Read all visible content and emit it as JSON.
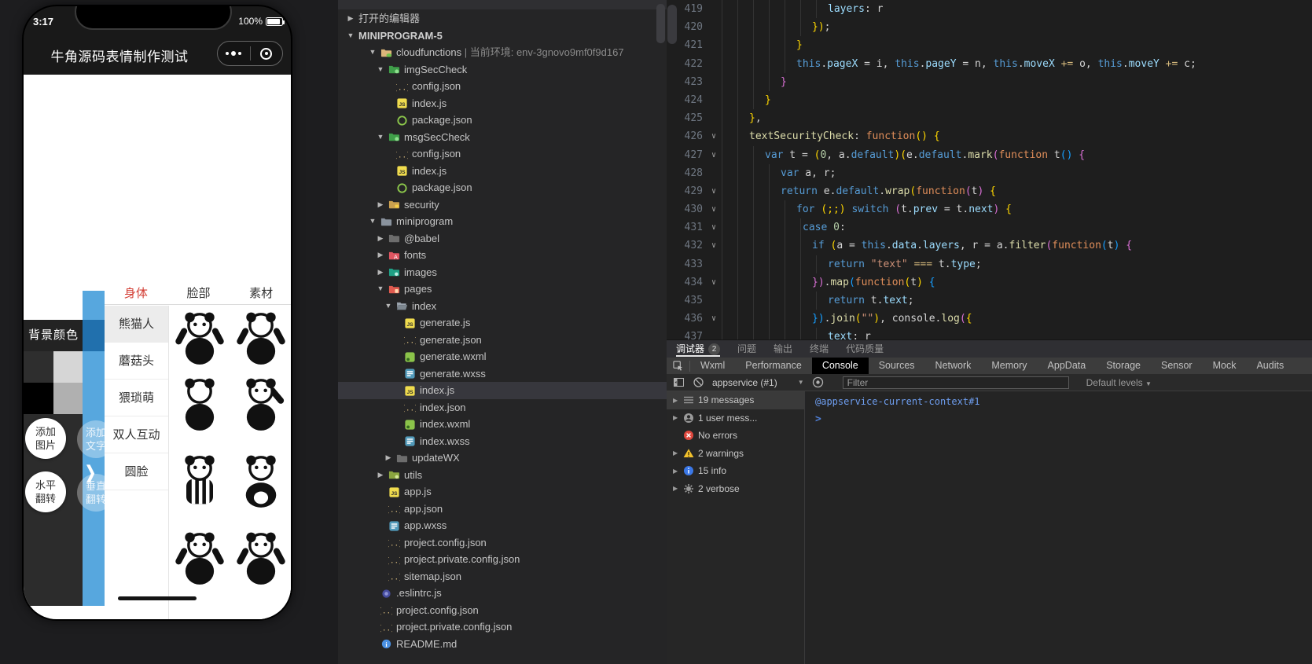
{
  "colors": {
    "accent_blue": "#57a7de",
    "drawer_dark_blue": "#2170ad",
    "tab_active_red": "#d23b31",
    "console_link_blue": "#6e9ef0",
    "swatch_indicator": "#d63c5e"
  },
  "simulator": {
    "status_time": "3:17",
    "battery_percent": "100%",
    "nav_title": "牛角源码表情制作测试",
    "tabs": [
      {
        "label": "身体",
        "active": true
      },
      {
        "label": "脸部",
        "active": false
      },
      {
        "label": "素材",
        "active": false
      }
    ],
    "color_panel": {
      "title": "背景颜色",
      "swatches": [
        "#ffffff",
        "#2e2e2e",
        "#d6d6d6",
        "#000000",
        "#b0b0b0"
      ]
    },
    "categories": [
      {
        "label": "熊猫人",
        "selected": true
      },
      {
        "label": "蘑菇头",
        "selected": false
      },
      {
        "label": "猥琐萌",
        "selected": false
      },
      {
        "label": "双人互动",
        "selected": false
      },
      {
        "label": "圆脸",
        "selected": false
      }
    ],
    "action_buttons": [
      {
        "label": "添加图片",
        "tinted": false
      },
      {
        "label": "添加文字",
        "tinted": true
      },
      {
        "label": "水平翻转",
        "tinted": false
      },
      {
        "label": "垂直翻转",
        "tinted": true
      }
    ],
    "stickers": [
      {
        "variant": "hug"
      },
      {
        "variant": "cheer"
      },
      {
        "variant": "back"
      },
      {
        "variant": "point"
      },
      {
        "variant": "pajama"
      },
      {
        "variant": "sit"
      },
      {
        "variant": "wave"
      },
      {
        "variant": "wave2"
      }
    ]
  },
  "explorer": {
    "items": [
      {
        "indent": 0,
        "arrow": "right",
        "icon": null,
        "label": "打开的编辑器",
        "bold": false
      },
      {
        "indent": 0,
        "arrow": "down",
        "icon": null,
        "label": "MINIPROGRAM-5",
        "bold": true
      },
      {
        "indent": 1,
        "arrow": "down",
        "icon": "folder-cloud",
        "label": "cloudfunctions",
        "extra": " | 当前环境: env-3gnovo9mf0f9d167"
      },
      {
        "indent": 2,
        "arrow": "down",
        "icon": "folder-func",
        "label": "imgSecCheck"
      },
      {
        "indent": 3,
        "icon": "json",
        "label": "config.json"
      },
      {
        "indent": 3,
        "icon": "js",
        "label": "index.js"
      },
      {
        "indent": 3,
        "icon": "node",
        "label": "package.json"
      },
      {
        "indent": 2,
        "arrow": "down",
        "icon": "folder-func",
        "label": "msgSecCheck"
      },
      {
        "indent": 3,
        "icon": "json",
        "label": "config.json"
      },
      {
        "indent": 3,
        "icon": "js",
        "label": "index.js"
      },
      {
        "indent": 3,
        "icon": "node",
        "label": "package.json"
      },
      {
        "indent": 2,
        "arrow": "right",
        "icon": "folder-lock",
        "label": "security"
      },
      {
        "indent": 1,
        "arrow": "down",
        "icon": "folder-mini",
        "label": "miniprogram"
      },
      {
        "indent": 2,
        "arrow": "right",
        "icon": "folder-plain",
        "label": "@babel"
      },
      {
        "indent": 2,
        "arrow": "right",
        "icon": "folder-fonts",
        "label": "fonts"
      },
      {
        "indent": 2,
        "arrow": "right",
        "icon": "folder-images",
        "label": "images"
      },
      {
        "indent": 2,
        "arrow": "down",
        "icon": "folder-pages",
        "label": "pages"
      },
      {
        "indent": 3,
        "arrow": "down",
        "icon": "folder-open",
        "label": "index"
      },
      {
        "indent": 4,
        "icon": "js",
        "label": "generate.js"
      },
      {
        "indent": 4,
        "icon": "json",
        "label": "generate.json"
      },
      {
        "indent": 4,
        "icon": "wxml",
        "label": "generate.wxml"
      },
      {
        "indent": 4,
        "icon": "wxss",
        "label": "generate.wxss"
      },
      {
        "indent": 4,
        "icon": "js",
        "label": "index.js",
        "selected": true
      },
      {
        "indent": 4,
        "icon": "json",
        "label": "index.json"
      },
      {
        "indent": 4,
        "icon": "wxml",
        "label": "index.wxml"
      },
      {
        "indent": 4,
        "icon": "wxss",
        "label": "index.wxss"
      },
      {
        "indent": 3,
        "arrow": "right",
        "icon": "folder-plain",
        "label": "updateWX"
      },
      {
        "indent": 2,
        "arrow": "right",
        "icon": "folder-utils",
        "label": "utils"
      },
      {
        "indent": 2,
        "icon": "js",
        "label": "app.js"
      },
      {
        "indent": 2,
        "icon": "json",
        "label": "app.json"
      },
      {
        "indent": 2,
        "icon": "wxss",
        "label": "app.wxss"
      },
      {
        "indent": 2,
        "icon": "json",
        "label": "project.config.json"
      },
      {
        "indent": 2,
        "icon": "json",
        "label": "project.private.config.json"
      },
      {
        "indent": 2,
        "icon": "json",
        "label": "sitemap.json"
      },
      {
        "indent": 1,
        "icon": "eslint",
        "label": ".eslintrc.js"
      },
      {
        "indent": 1,
        "icon": "json",
        "label": "project.config.json"
      },
      {
        "indent": 1,
        "icon": "json",
        "label": "project.private.config.json"
      },
      {
        "indent": 1,
        "icon": "readme",
        "label": "README.md"
      }
    ]
  },
  "editor": {
    "lines": [
      {
        "n": 419,
        "fold": false,
        "indent": 5,
        "tokens": [
          [
            "p",
            "layers"
          ],
          [
            "t",
            ": r"
          ]
        ]
      },
      {
        "n": 420,
        "fold": false,
        "indent": 4,
        "tokens": [
          [
            "g",
            "})"
          ],
          [
            "t",
            ";"
          ]
        ]
      },
      {
        "n": 421,
        "fold": false,
        "indent": 3,
        "tokens": [
          [
            "g",
            "}"
          ]
        ]
      },
      {
        "n": 422,
        "fold": false,
        "indent": 3,
        "tokens": [
          [
            "k",
            "this"
          ],
          [
            "t",
            "."
          ],
          [
            "p",
            "pageX"
          ],
          [
            "t",
            " = i, "
          ],
          [
            "k",
            "this"
          ],
          [
            "t",
            "."
          ],
          [
            "p",
            "pageY"
          ],
          [
            "t",
            " = n, "
          ],
          [
            "k",
            "this"
          ],
          [
            "t",
            "."
          ],
          [
            "p",
            "moveX"
          ],
          [
            "y",
            " += "
          ],
          [
            "t",
            "o, "
          ],
          [
            "k",
            "this"
          ],
          [
            "t",
            "."
          ],
          [
            "p",
            "moveY"
          ],
          [
            "y",
            " += "
          ],
          [
            "t",
            "c;"
          ]
        ]
      },
      {
        "n": 423,
        "fold": false,
        "indent": 2,
        "tokens": [
          [
            "m",
            "}"
          ]
        ]
      },
      {
        "n": 424,
        "fold": false,
        "indent": 1,
        "tokens": [
          [
            "g",
            "}"
          ]
        ]
      },
      {
        "n": 425,
        "fold": false,
        "indent": 0,
        "tokens": [
          [
            "g",
            "}"
          ],
          [
            "t",
            ","
          ]
        ]
      },
      {
        "n": 426,
        "fold": true,
        "indent": 0,
        "tokens": [
          [
            "f",
            "textSecurityCheck"
          ],
          [
            "t",
            ": "
          ],
          [
            "o",
            "function"
          ],
          [
            "g",
            "()"
          ],
          [
            "t",
            " "
          ],
          [
            "g",
            "{"
          ]
        ]
      },
      {
        "n": 427,
        "fold": true,
        "indent": 1,
        "tokens": [
          [
            "k",
            "var"
          ],
          [
            "t",
            " t = "
          ],
          [
            "g",
            "("
          ],
          [
            "n",
            "0"
          ],
          [
            "t",
            ", a."
          ],
          [
            "k",
            "default"
          ],
          [
            "g",
            ")("
          ],
          [
            "t",
            "e."
          ],
          [
            "k",
            "default"
          ],
          [
            "t",
            "."
          ],
          [
            "f",
            "mark"
          ],
          [
            "m",
            "("
          ],
          [
            "o",
            "function"
          ],
          [
            "t",
            " t"
          ],
          [
            "b",
            "()"
          ],
          [
            "t",
            " "
          ],
          [
            "m",
            "{"
          ]
        ]
      },
      {
        "n": 428,
        "fold": false,
        "indent": 2,
        "tokens": [
          [
            "k",
            "var"
          ],
          [
            "t",
            " a, r;"
          ]
        ]
      },
      {
        "n": 429,
        "fold": true,
        "indent": 2,
        "tokens": [
          [
            "k",
            "return"
          ],
          [
            "t",
            " e."
          ],
          [
            "k",
            "default"
          ],
          [
            "t",
            "."
          ],
          [
            "f",
            "wrap"
          ],
          [
            "g",
            "("
          ],
          [
            "o",
            "function"
          ],
          [
            "m",
            "("
          ],
          [
            "t",
            "t"
          ],
          [
            "m",
            ")"
          ],
          [
            "t",
            " "
          ],
          [
            "g",
            "{"
          ]
        ]
      },
      {
        "n": 430,
        "fold": true,
        "indent": 3,
        "tokens": [
          [
            "k",
            "for"
          ],
          [
            "t",
            " "
          ],
          [
            "g",
            "(;;)"
          ],
          [
            "t",
            " "
          ],
          [
            "k",
            "switch"
          ],
          [
            "t",
            " "
          ],
          [
            "m",
            "("
          ],
          [
            "t",
            "t."
          ],
          [
            "p",
            "prev"
          ],
          [
            "t",
            " = t."
          ],
          [
            "p",
            "next"
          ],
          [
            "m",
            ")"
          ],
          [
            "t",
            " "
          ],
          [
            "g",
            "{"
          ]
        ]
      },
      {
        "n": 431,
        "fold": true,
        "indent": 3.4,
        "tokens": [
          [
            "k",
            "case"
          ],
          [
            "t",
            " "
          ],
          [
            "n",
            "0"
          ],
          [
            "t",
            ":"
          ]
        ]
      },
      {
        "n": 432,
        "fold": true,
        "indent": 4,
        "tokens": [
          [
            "k",
            "if"
          ],
          [
            "t",
            " "
          ],
          [
            "g",
            "("
          ],
          [
            "t",
            "a = "
          ],
          [
            "k",
            "this"
          ],
          [
            "t",
            "."
          ],
          [
            "p",
            "data"
          ],
          [
            "t",
            "."
          ],
          [
            "p",
            "layers"
          ],
          [
            "t",
            ", r = a."
          ],
          [
            "f",
            "filter"
          ],
          [
            "m",
            "("
          ],
          [
            "o",
            "function"
          ],
          [
            "b",
            "("
          ],
          [
            "t",
            "t"
          ],
          [
            "b",
            ")"
          ],
          [
            "t",
            " "
          ],
          [
            "m",
            "{"
          ]
        ]
      },
      {
        "n": 433,
        "fold": false,
        "indent": 5,
        "tokens": [
          [
            "k",
            "return"
          ],
          [
            "t",
            " "
          ],
          [
            "s",
            "\"text\""
          ],
          [
            "t",
            " "
          ],
          [
            "y",
            "==="
          ],
          [
            "t",
            " t."
          ],
          [
            "p",
            "type"
          ],
          [
            "t",
            ";"
          ]
        ]
      },
      {
        "n": 434,
        "fold": true,
        "indent": 4,
        "tokens": [
          [
            "m",
            "})"
          ],
          [
            "t",
            "."
          ],
          [
            "f",
            "map"
          ],
          [
            "b",
            "("
          ],
          [
            "o",
            "function"
          ],
          [
            "g",
            "("
          ],
          [
            "t",
            "t"
          ],
          [
            "g",
            ")"
          ],
          [
            "t",
            " "
          ],
          [
            "b",
            "{"
          ]
        ]
      },
      {
        "n": 435,
        "fold": false,
        "indent": 5,
        "tokens": [
          [
            "k",
            "return"
          ],
          [
            "t",
            " t."
          ],
          [
            "p",
            "text"
          ],
          [
            "t",
            ";"
          ]
        ]
      },
      {
        "n": 436,
        "fold": true,
        "indent": 4,
        "tokens": [
          [
            "b",
            "})"
          ],
          [
            "t",
            "."
          ],
          [
            "f",
            "join"
          ],
          [
            "g",
            "("
          ],
          [
            "s",
            "\"\""
          ],
          [
            "g",
            ")"
          ],
          [
            "t",
            ", console."
          ],
          [
            "f",
            "log"
          ],
          [
            "m",
            "("
          ],
          [
            "g",
            "{"
          ]
        ]
      },
      {
        "n": 437,
        "fold": false,
        "indent": 5,
        "tokens": [
          [
            "p",
            "text"
          ],
          [
            "t",
            ": r"
          ]
        ]
      }
    ]
  },
  "debugger": {
    "panel_tabs": [
      {
        "label": "调试器",
        "badge": "2",
        "active": true
      },
      {
        "label": "问题",
        "active": false
      },
      {
        "label": "输出",
        "active": false
      },
      {
        "label": "终端",
        "active": false
      },
      {
        "label": "代码质量",
        "active": false
      }
    ],
    "devtools_tabs": [
      {
        "label": "Wxml"
      },
      {
        "label": "Performance"
      },
      {
        "label": "Console",
        "active": true
      },
      {
        "label": "Sources"
      },
      {
        "label": "Network"
      },
      {
        "label": "Memory"
      },
      {
        "label": "AppData"
      },
      {
        "label": "Storage"
      },
      {
        "label": "Sensor"
      },
      {
        "label": "Mock"
      },
      {
        "label": "Audits"
      }
    ],
    "toolbar": {
      "context": "appservice (#1)",
      "filter_placeholder": "Filter",
      "levels": "Default levels"
    },
    "sidebar": [
      {
        "icon": "list-icon",
        "label": "19 messages",
        "selected": true,
        "arrow": true
      },
      {
        "icon": "user-icon",
        "label": "1 user mess...",
        "selected": false,
        "arrow": true
      },
      {
        "icon": "error-icon",
        "label": "No errors",
        "selected": false,
        "arrow": false
      },
      {
        "icon": "warning-icon",
        "label": "2 warnings",
        "selected": false,
        "arrow": true
      },
      {
        "icon": "info-icon",
        "label": "15 info",
        "selected": false,
        "arrow": true
      },
      {
        "icon": "verbose-icon",
        "label": "2 verbose",
        "selected": false,
        "arrow": true
      }
    ],
    "console": {
      "context_link": "@appservice-current-context#1",
      "prompt": ">"
    }
  }
}
